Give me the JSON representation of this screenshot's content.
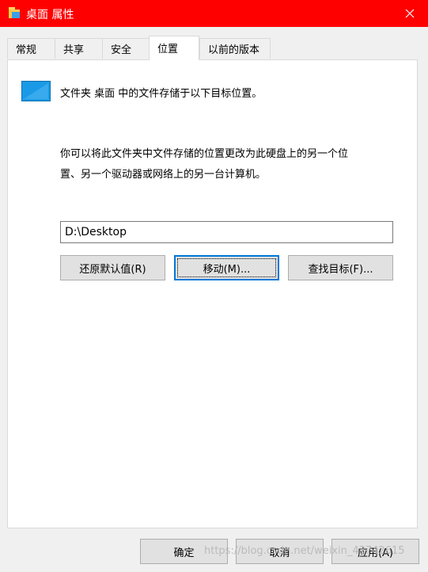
{
  "window": {
    "title": "桌面 属性",
    "title_color": "#ff0000"
  },
  "tabs": [
    {
      "label": "常规"
    },
    {
      "label": "共享"
    },
    {
      "label": "安全"
    },
    {
      "label": "位置",
      "active": true
    },
    {
      "label": "以前的版本"
    }
  ],
  "location": {
    "heading": "文件夹 桌面 中的文件存储于以下目标位置。",
    "description_line1": "你可以将此文件夹中文件存储的位置更改为此硬盘上的另一个位",
    "description_line2": "置、另一个驱动器或网络上的另一台计算机。",
    "path_value": "D:\\Desktop",
    "restore_label": "还原默认值(R)",
    "move_label": "移动(M)...",
    "find_label": "查找目标(F)..."
  },
  "footer": {
    "ok_label": "确定",
    "cancel_label": "取消",
    "apply_label": "应用(A)"
  },
  "watermark": "https://blog.csdn.net/weixin_43742615",
  "colors": {
    "accent": "#0078d7",
    "folder": "#1a9ae6"
  }
}
